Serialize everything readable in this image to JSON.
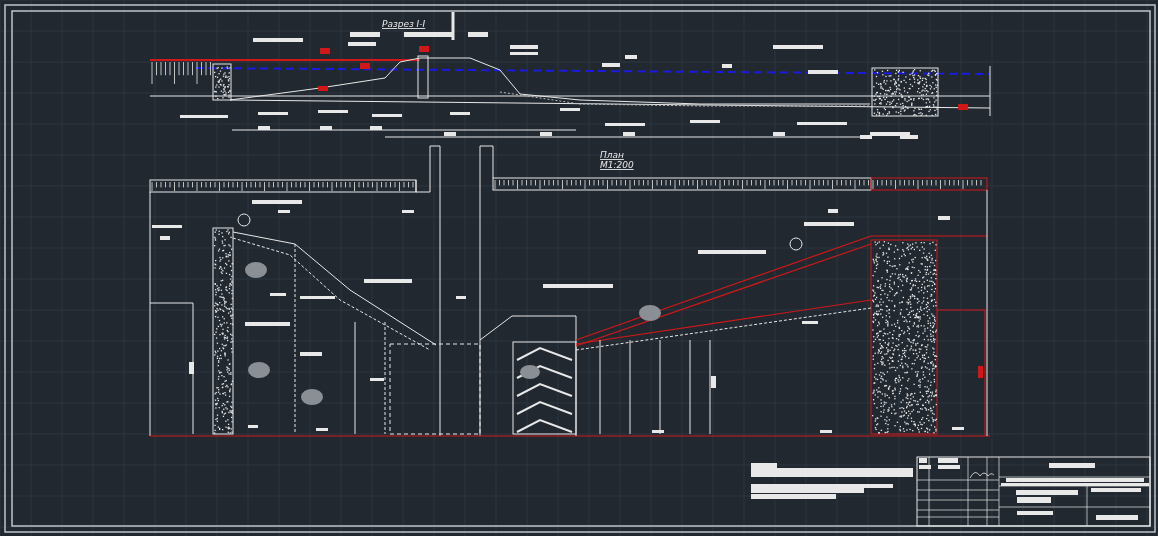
{
  "drawing": {
    "section_title": "Разрез I-I",
    "plan_title": "План",
    "plan_scale": "М1:200"
  }
}
